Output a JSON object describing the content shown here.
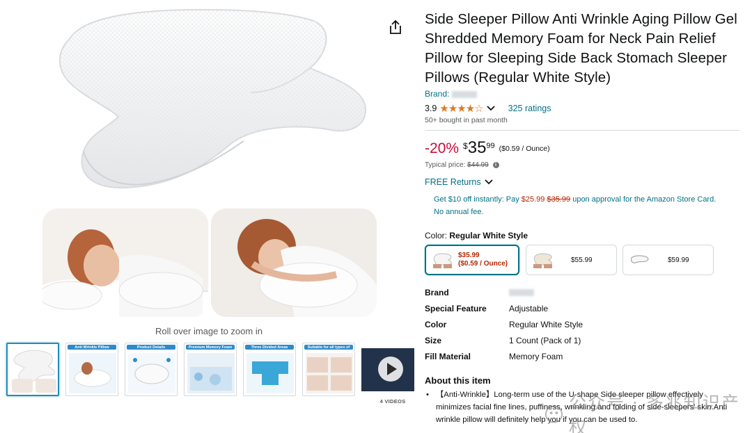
{
  "product": {
    "title": "Side Sleeper Pillow Anti Wrinkle Aging Pillow Gel Shredded Memory Foam for Neck Pain Relief Pillow for Sleeping Side Back Stomach Sleeper Pillows (Regular White Style)",
    "brand_label": "Brand:",
    "rating": "3.9",
    "stars": "★★★★☆",
    "ratings_count": "325 ratings",
    "bought": "50+ bought in past month"
  },
  "price": {
    "discount": "-20%",
    "symbol": "$",
    "whole": "35",
    "fraction": "99",
    "unit_price": "($0.59 / Ounce)",
    "typical_label": "Typical price:",
    "typical_value": "$44.99",
    "info_glyph": "i"
  },
  "returns": {
    "label": "FREE Returns"
  },
  "card_offer": {
    "prefix": "Get $10 off instantly: Pay",
    "new_price": "$25.99",
    "old_price": "$35.99",
    "suffix": "upon approval for the Amazon Store Card. No annual fee."
  },
  "color": {
    "label": "Color:",
    "selected": "Regular White Style",
    "options": [
      {
        "price": "$35.99",
        "unit": "($0.59 / Ounce)"
      },
      {
        "price": "$55.99"
      },
      {
        "price": "$59.99"
      }
    ]
  },
  "specs": [
    {
      "key": "Brand",
      "value": ""
    },
    {
      "key": "Special Feature",
      "value": "Adjustable"
    },
    {
      "key": "Color",
      "value": "Regular White Style"
    },
    {
      "key": "Size",
      "value": "1 Count (Pack of 1)"
    },
    {
      "key": "Fill Material",
      "value": "Memory Foam"
    }
  ],
  "about": {
    "heading": "About this item",
    "bullet": "【Anti-Wrinkle】Long-term use of the U-shape Side sleeper pillow effectively minimizes facial fine lines, puffiness, wrinkling and folding of side-sleepers' skin.Anti wrinkle pillow will definitely help you if you can be used to."
  },
  "gallery": {
    "zoom_hint": "Roll over image to zoom in",
    "thumb_titles": [
      "",
      "Anti Wrinkle Pillow",
      "Product Details",
      "Premium Memory Foam",
      "Three Divided Areas",
      "Suitable for all types of sleepers"
    ],
    "video_count": "4 VIDEOS"
  },
  "watermark": {
    "text": "公众号 · 多兆知识产权"
  },
  "colors": {
    "link": "#007185",
    "deal_red": "#cc0c39",
    "price_red": "#b12704",
    "star": "#de7921"
  },
  "icons": [
    "share-icon",
    "chevron-down-icon",
    "info-icon",
    "play-icon"
  ]
}
